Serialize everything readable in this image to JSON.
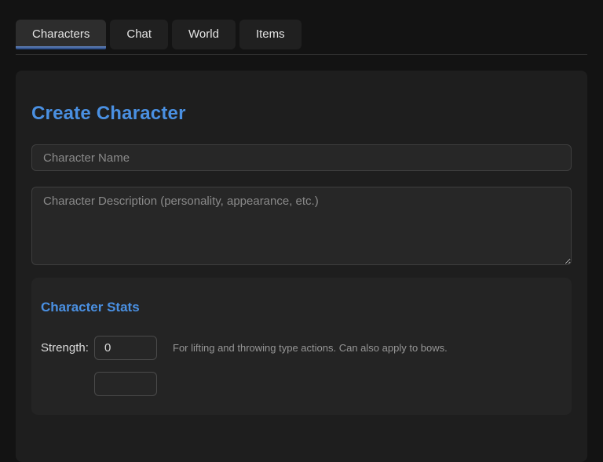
{
  "tabs": [
    {
      "label": "Characters",
      "active": true
    },
    {
      "label": "Chat",
      "active": false
    },
    {
      "label": "World",
      "active": false
    },
    {
      "label": "Items",
      "active": false
    }
  ],
  "create_character": {
    "title": "Create Character",
    "name_placeholder": "Character Name",
    "description_placeholder": "Character Description (personality, appearance, etc.)",
    "stats": {
      "title": "Character Stats",
      "rows": [
        {
          "label": "Strength:",
          "value": "0",
          "hint": "For lifting and throwing type actions. Can also apply to bows."
        }
      ]
    }
  },
  "colors": {
    "accent": "#4a90e2",
    "tab_underline": "#35619f",
    "page_background": "#131313",
    "card_background": "#1e1e1e",
    "panel_background": "#242424"
  }
}
